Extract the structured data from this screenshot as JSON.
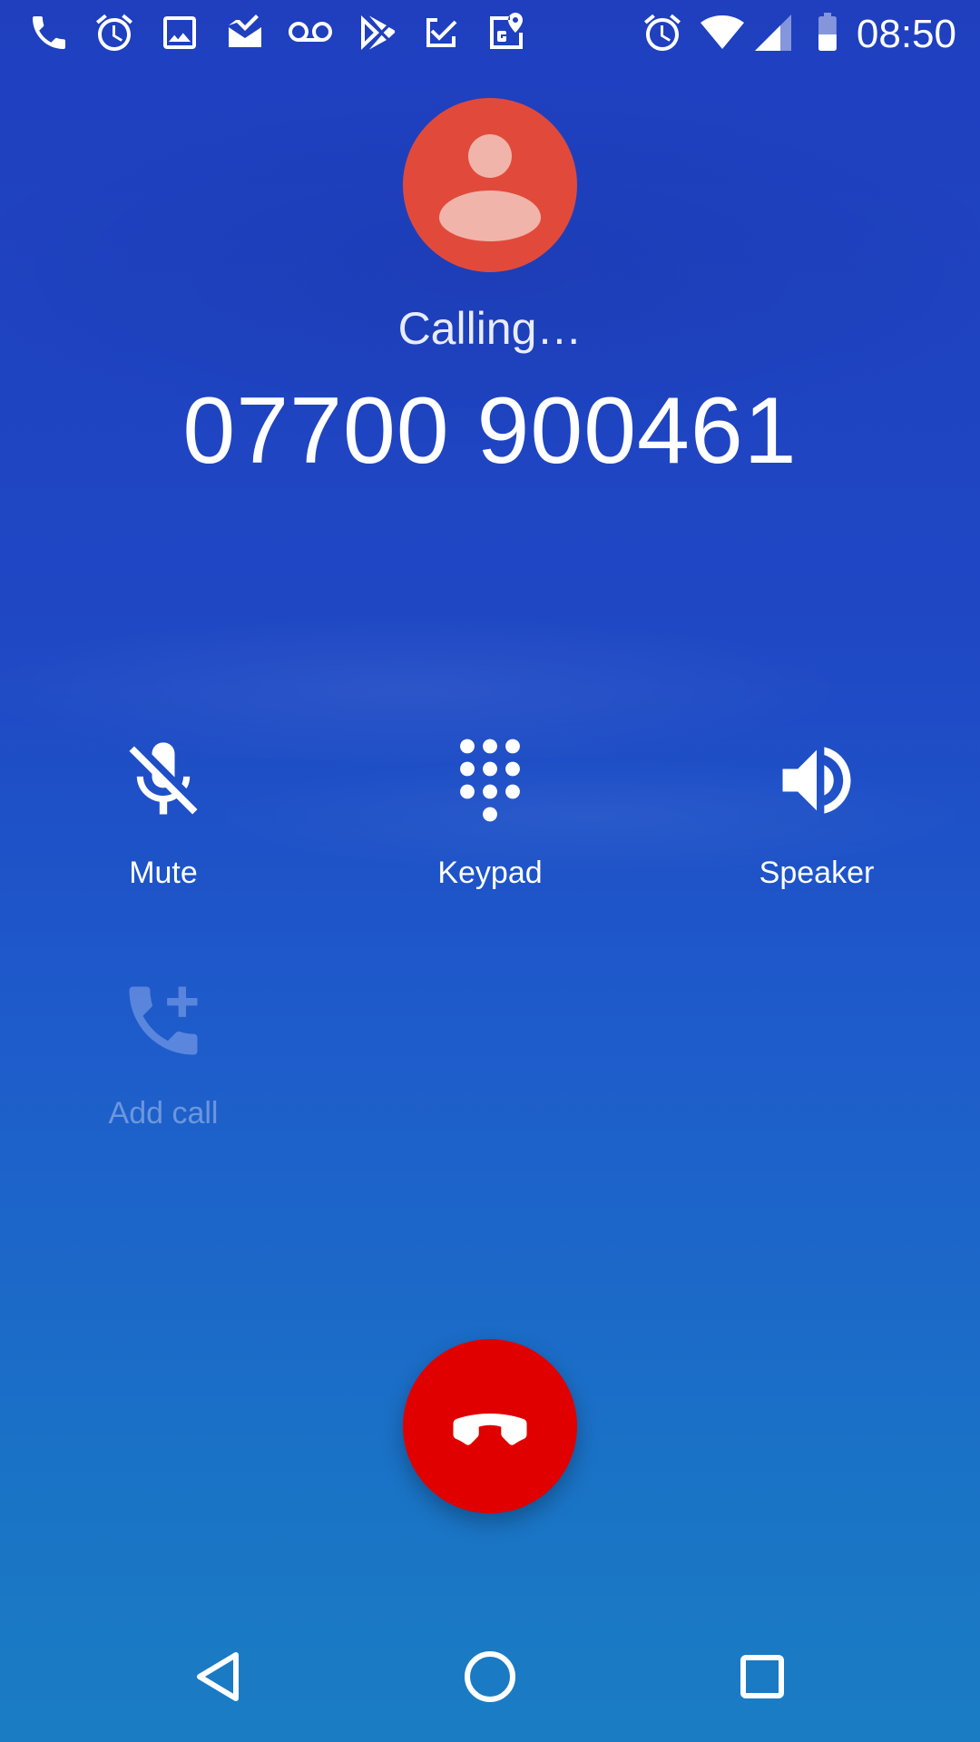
{
  "status_bar": {
    "time": "08:50",
    "left_icons": [
      "phone-icon",
      "alarm-icon",
      "image-icon",
      "mail-check-icon",
      "voicemail-icon",
      "play-store-icon",
      "tasks-check-icon",
      "maps-icon"
    ],
    "right_icons": [
      "alarm-icon",
      "wifi-icon",
      "signal-icon",
      "battery-icon"
    ]
  },
  "call": {
    "status": "Calling…",
    "number": "07700 900461",
    "avatar_color": "#e14a3b"
  },
  "controls": {
    "mute_label": "Mute",
    "keypad_label": "Keypad",
    "speaker_label": "Speaker",
    "add_call_label": "Add call"
  },
  "end_call": {
    "color": "#e00000",
    "icon": "hang-up-icon"
  },
  "nav_bar": {
    "icons": [
      "back-icon",
      "home-icon",
      "recents-icon"
    ]
  },
  "theme": {
    "background_top": "#1f3fbf",
    "background_bottom": "#1a7dc3"
  }
}
